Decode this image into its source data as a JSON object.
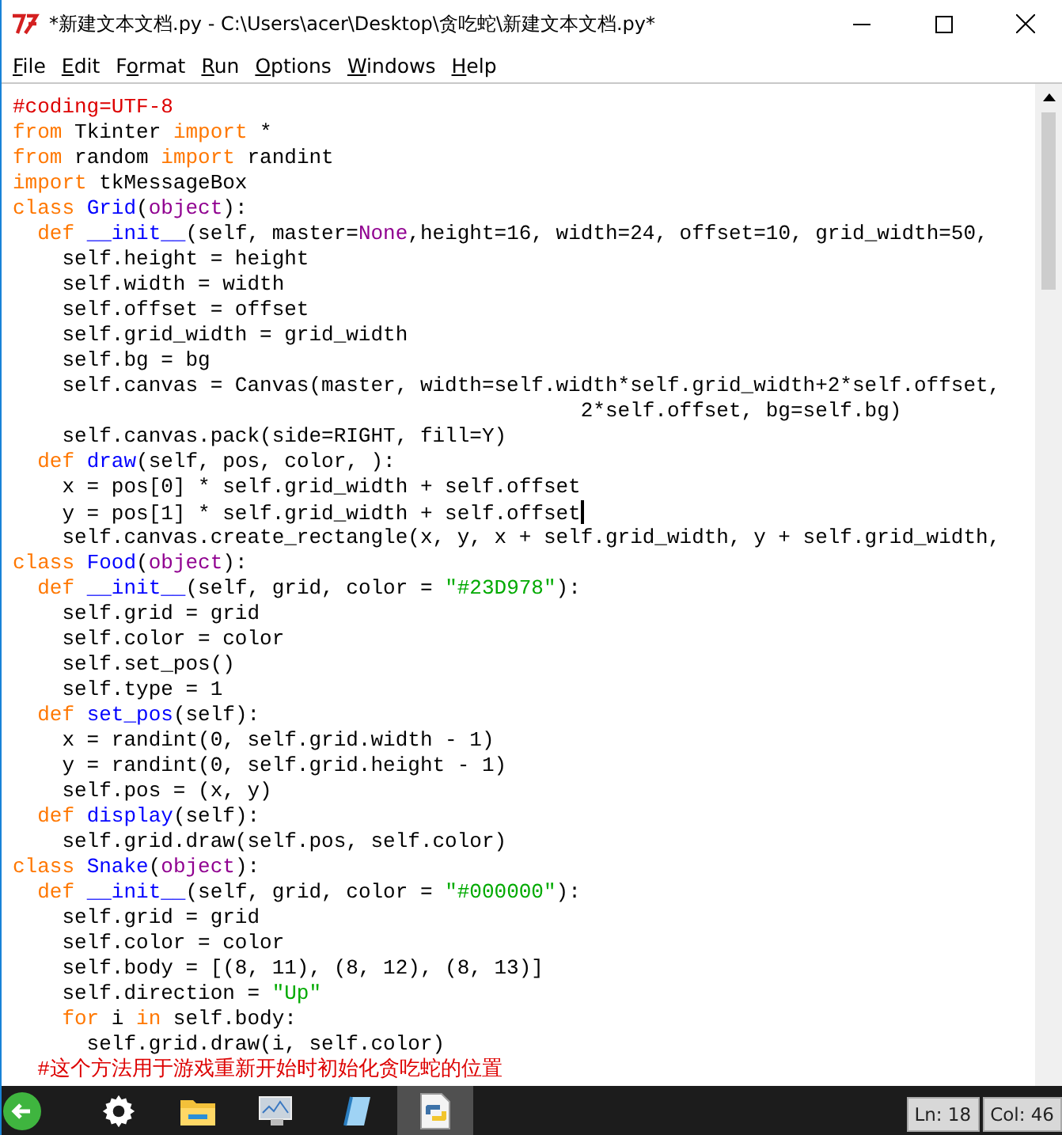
{
  "window": {
    "title": "*新建文本文档.py - C:\\Users\\acer\\Desktop\\贪吃蛇\\新建文本文档.py*"
  },
  "menu": [
    {
      "parts": [
        {
          "text": "F",
          "underlined": true
        },
        {
          "text": "ile",
          "underlined": false
        }
      ]
    },
    {
      "parts": [
        {
          "text": "E",
          "underlined": true
        },
        {
          "text": "dit",
          "underlined": false
        }
      ]
    },
    {
      "parts": [
        {
          "text": "F",
          "underlined": false
        },
        {
          "text": "o",
          "underlined": true
        },
        {
          "text": "rmat",
          "underlined": false
        }
      ]
    },
    {
      "parts": [
        {
          "text": "R",
          "underlined": true
        },
        {
          "text": "un",
          "underlined": false
        }
      ]
    },
    {
      "parts": [
        {
          "text": "O",
          "underlined": true
        },
        {
          "text": "ptions",
          "underlined": false
        }
      ]
    },
    {
      "parts": [
        {
          "text": "W",
          "underlined": true
        },
        {
          "text": "indows",
          "underlined": false
        }
      ]
    },
    {
      "parts": [
        {
          "text": "H",
          "underlined": true
        },
        {
          "text": "elp",
          "underlined": false
        }
      ]
    }
  ],
  "editor": {
    "lines": [
      [
        {
          "text": "#coding=UTF-8",
          "kind": "comment"
        }
      ],
      [
        {
          "text": "from",
          "kind": "keyword"
        },
        {
          "text": " Tkinter ",
          "kind": "plain"
        },
        {
          "text": "import",
          "kind": "keyword"
        },
        {
          "text": " *",
          "kind": "plain"
        }
      ],
      [
        {
          "text": "from",
          "kind": "keyword"
        },
        {
          "text": " random ",
          "kind": "plain"
        },
        {
          "text": "import",
          "kind": "keyword"
        },
        {
          "text": " randint",
          "kind": "plain"
        }
      ],
      [
        {
          "text": "import",
          "kind": "keyword"
        },
        {
          "text": " tkMessageBox",
          "kind": "plain"
        }
      ],
      [
        {
          "text": "class",
          "kind": "keyword"
        },
        {
          "text": " Grid",
          "kind": "definition"
        },
        {
          "text": "(",
          "kind": "plain"
        },
        {
          "text": "object",
          "kind": "builtin"
        },
        {
          "text": "):",
          "kind": "plain"
        }
      ],
      [
        {
          "text": "  def",
          "kind": "keyword"
        },
        {
          "text": " __init__",
          "kind": "definition"
        },
        {
          "text": "(self, master=",
          "kind": "plain"
        },
        {
          "text": "None",
          "kind": "builtin"
        },
        {
          "text": ",height=16, width=24, offset=10, grid_width=50,",
          "kind": "plain"
        }
      ],
      [
        {
          "text": "    self.height = height",
          "kind": "plain"
        }
      ],
      [
        {
          "text": "    self.width = width",
          "kind": "plain"
        }
      ],
      [
        {
          "text": "    self.offset = offset",
          "kind": "plain"
        }
      ],
      [
        {
          "text": "    self.grid_width = grid_width",
          "kind": "plain"
        }
      ],
      [
        {
          "text": "    self.bg = bg",
          "kind": "plain"
        }
      ],
      [
        {
          "text": "    self.canvas = Canvas(master, width=self.width*self.grid_width+2*self.offset,",
          "kind": "plain"
        }
      ],
      [
        {
          "text": "                                              2*self.offset, bg=self.bg)",
          "kind": "plain"
        }
      ],
      [
        {
          "text": "    self.canvas.pack(side=RIGHT, fill=Y)",
          "kind": "plain"
        }
      ],
      [
        {
          "text": "  def",
          "kind": "keyword"
        },
        {
          "text": " draw",
          "kind": "definition"
        },
        {
          "text": "(self, pos, color, ):",
          "kind": "plain"
        }
      ],
      [
        {
          "text": "    x = pos[0] * self.grid_width + self.offset",
          "kind": "plain"
        }
      ],
      [
        {
          "text": "    y = pos[1] * self.grid_width + self.offset",
          "kind": "plain"
        },
        {
          "kind": "cursor"
        }
      ],
      [
        {
          "text": "    self.canvas.create_rectangle(x, y, x + self.grid_width, y + self.grid_width,",
          "kind": "plain"
        }
      ],
      [
        {
          "text": "class",
          "kind": "keyword"
        },
        {
          "text": " Food",
          "kind": "definition"
        },
        {
          "text": "(",
          "kind": "plain"
        },
        {
          "text": "object",
          "kind": "builtin"
        },
        {
          "text": "):",
          "kind": "plain"
        }
      ],
      [
        {
          "text": "  def",
          "kind": "keyword"
        },
        {
          "text": " __init__",
          "kind": "definition"
        },
        {
          "text": "(self, grid, color = ",
          "kind": "plain"
        },
        {
          "text": "\"#23D978\"",
          "kind": "string"
        },
        {
          "text": "):",
          "kind": "plain"
        }
      ],
      [
        {
          "text": "    self.grid = grid",
          "kind": "plain"
        }
      ],
      [
        {
          "text": "    self.color = color",
          "kind": "plain"
        }
      ],
      [
        {
          "text": "    self.set_pos()",
          "kind": "plain"
        }
      ],
      [
        {
          "text": "    self.type = 1",
          "kind": "plain"
        }
      ],
      [
        {
          "text": "  def",
          "kind": "keyword"
        },
        {
          "text": " set_pos",
          "kind": "definition"
        },
        {
          "text": "(self):",
          "kind": "plain"
        }
      ],
      [
        {
          "text": "    x = randint(0, self.grid.width - 1)",
          "kind": "plain"
        }
      ],
      [
        {
          "text": "    y = randint(0, self.grid.height - 1)",
          "kind": "plain"
        }
      ],
      [
        {
          "text": "    self.pos = (x, y)",
          "kind": "plain"
        }
      ],
      [
        {
          "text": "  def",
          "kind": "keyword"
        },
        {
          "text": " display",
          "kind": "definition"
        },
        {
          "text": "(self):",
          "kind": "plain"
        }
      ],
      [
        {
          "text": "    self.grid.draw(self.pos, self.color)",
          "kind": "plain"
        }
      ],
      [
        {
          "text": "class",
          "kind": "keyword"
        },
        {
          "text": " Snake",
          "kind": "definition"
        },
        {
          "text": "(",
          "kind": "plain"
        },
        {
          "text": "object",
          "kind": "builtin"
        },
        {
          "text": "):",
          "kind": "plain"
        }
      ],
      [
        {
          "text": "  def",
          "kind": "keyword"
        },
        {
          "text": " __init__",
          "kind": "definition"
        },
        {
          "text": "(self, grid, color = ",
          "kind": "plain"
        },
        {
          "text": "\"#000000\"",
          "kind": "string"
        },
        {
          "text": "):",
          "kind": "plain"
        }
      ],
      [
        {
          "text": "    self.grid = grid",
          "kind": "plain"
        }
      ],
      [
        {
          "text": "    self.color = color",
          "kind": "plain"
        }
      ],
      [
        {
          "text": "    self.body = [(8, 11), (8, 12), (8, 13)]",
          "kind": "plain"
        }
      ],
      [
        {
          "text": "    self.direction = ",
          "kind": "plain"
        },
        {
          "text": "\"Up\"",
          "kind": "string"
        }
      ],
      [
        {
          "text": "    for",
          "kind": "keyword"
        },
        {
          "text": " i ",
          "kind": "plain"
        },
        {
          "text": "in",
          "kind": "keyword"
        },
        {
          "text": " self.body:",
          "kind": "plain"
        }
      ],
      [
        {
          "text": "      self.grid.draw(i, self.color)",
          "kind": "plain"
        }
      ],
      [
        {
          "text": "  #这个方法用于游戏重新开始时初始化贪吃蛇的位置",
          "kind": "comment"
        }
      ]
    ]
  },
  "taskbar": [
    {
      "kind": "start",
      "selected": false
    },
    {
      "kind": "settings",
      "selected": false
    },
    {
      "kind": "folder",
      "selected": false
    },
    {
      "kind": "monitor",
      "selected": false
    },
    {
      "kind": "notepad",
      "selected": false
    },
    {
      "kind": "python",
      "selected": true
    }
  ],
  "status_bar": {
    "line": "Ln: 18",
    "column": "Col: 46"
  }
}
